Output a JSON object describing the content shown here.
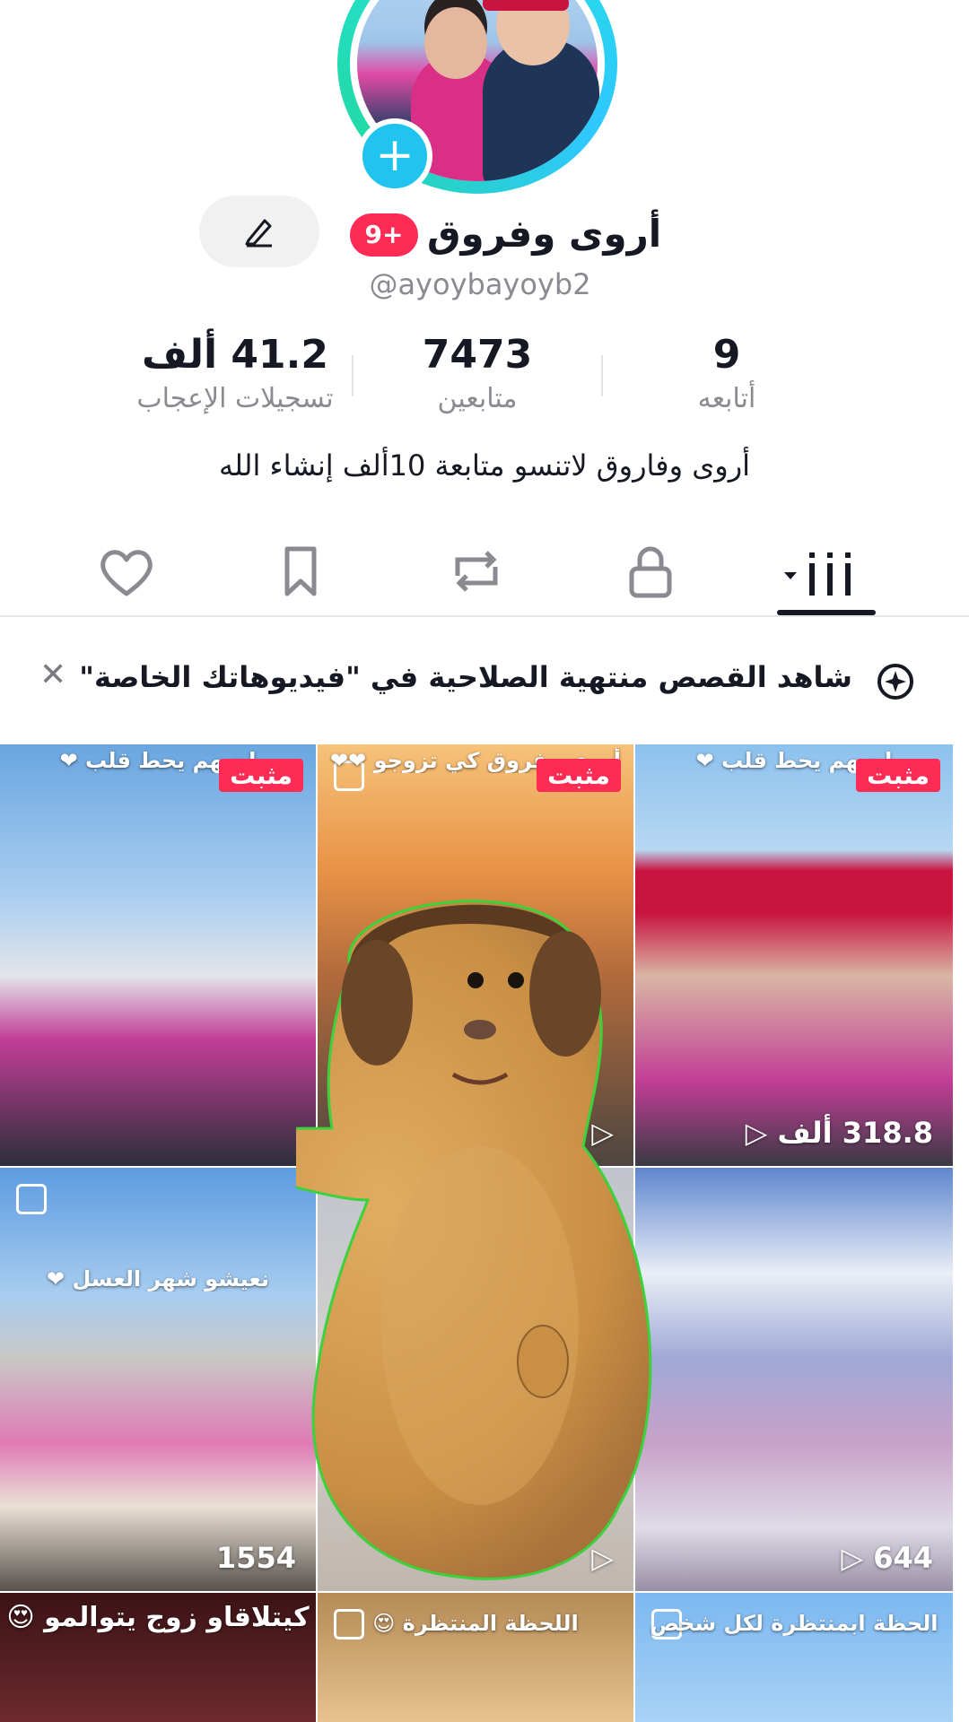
{
  "profile": {
    "display_name": "أروى وفروق",
    "badge": "9+",
    "handle": "@ayoybayoyb2",
    "bio": "أروى وفاروق لاتنسو متابعة 10ألف إنشاء الله"
  },
  "stats": [
    {
      "value": "9",
      "label": "أتابعه"
    },
    {
      "value": "7473",
      "label": "متابعين"
    },
    {
      "value": "41.2 ألف",
      "label": "تسجيلات الإعجاب"
    }
  ],
  "tabs": [
    "videos-icon",
    "lock-icon",
    "repost-icon",
    "bookmark-icon",
    "heart-icon"
  ],
  "banner": {
    "text": "شاهد القصص منتهية الصلاحية في \"فيديوهاتك الخاصة\""
  },
  "videos": [
    {
      "caption": "لحبهم يحط قلب ❤",
      "pinned": "مثبت",
      "views": ""
    },
    {
      "caption": "أروى وفروق كي تزوجو ❤❤",
      "pinned": "مثبت",
      "views": ""
    },
    {
      "caption": "لحبهم يحط قلب ❤",
      "pinned": "مثبت",
      "views": "318.8 ألف"
    },
    {
      "caption": "نعيشو شهر العسل ❤",
      "pinned": "",
      "views": "1554"
    },
    {
      "caption": "",
      "pinned": "",
      "views": ""
    },
    {
      "caption": "",
      "pinned": "",
      "views": "644"
    },
    {
      "caption": "كيتلاقاو زوج يتوالمو 😍",
      "pinned": "",
      "views": ""
    },
    {
      "caption": "اللحظة المنتظرة 😍",
      "pinned": "",
      "views": ""
    },
    {
      "caption": "الحظة ابمنتظرة لكل شخص",
      "pinned": "",
      "views": ""
    }
  ]
}
